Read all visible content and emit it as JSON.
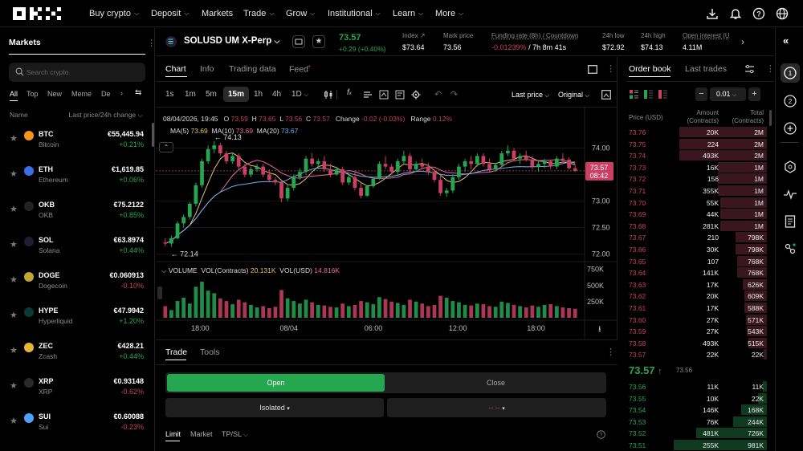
{
  "nav": {
    "logo": "OKX",
    "items": [
      {
        "label": "Buy crypto",
        "dropdown": true
      },
      {
        "label": "Deposit",
        "dropdown": true
      },
      {
        "label": "Markets",
        "dropdown": false
      },
      {
        "label": "Trade",
        "dropdown": true
      },
      {
        "label": "Grow",
        "dropdown": true
      },
      {
        "label": "Institutional",
        "dropdown": true
      },
      {
        "label": "Learn",
        "dropdown": true
      },
      {
        "label": "More",
        "dropdown": true
      }
    ],
    "right_icons": [
      "download-icon",
      "bell-icon",
      "help-icon",
      "globe-icon"
    ]
  },
  "markets": {
    "title": "Markets",
    "search_placeholder": "Search crypto",
    "filters": [
      "All",
      "Top",
      "New",
      "Meme",
      "De"
    ],
    "col_name": "Name",
    "col_price": "Last price/24h change",
    "rows": [
      {
        "sym": "BTC",
        "name": "Bitcoin",
        "price": "€55,445.94",
        "change": "+0.21%",
        "dir": "up",
        "color": "#f7931a"
      },
      {
        "sym": "ETH",
        "name": "Ethereum",
        "price": "€1,619.85",
        "change": "+0.06%",
        "dir": "up",
        "color": "#3b6ee8"
      },
      {
        "sym": "OKB",
        "name": "OKB",
        "price": "€75.2122",
        "change": "+0.85%",
        "dir": "up",
        "color": "#222222"
      },
      {
        "sym": "SOL",
        "name": "Solana",
        "price": "€63.8974",
        "change": "+0.44%",
        "dir": "up",
        "color": "#1f1f33"
      },
      {
        "sym": "DOGE",
        "name": "Dogecoin",
        "price": "€0.060913",
        "change": "-0.10%",
        "dir": "down",
        "color": "#c2a633"
      },
      {
        "sym": "HYPE",
        "name": "Hyperliquid",
        "price": "€47.9942",
        "change": "+1.20%",
        "dir": "up",
        "color": "#0c3a33"
      },
      {
        "sym": "ZEC",
        "name": "Zcash",
        "price": "€428.21",
        "change": "+0.44%",
        "dir": "up",
        "color": "#e8b43a"
      },
      {
        "sym": "XRP",
        "name": "XRP",
        "price": "€0.93148",
        "change": "-0.62%",
        "dir": "down",
        "color": "#2a2a2a"
      },
      {
        "sym": "SUI",
        "name": "Sui",
        "price": "€0.60088",
        "change": "-0.23%",
        "dir": "down",
        "color": "#4da2ff"
      }
    ]
  },
  "ticker": {
    "symbol": "SOLUSD UM X-Perp",
    "last": "73.57",
    "change": "+0.29 (+0.40%)",
    "stats": [
      {
        "label": "Index",
        "value": "$73.64"
      },
      {
        "label": "Mark price",
        "value": "73.56"
      },
      {
        "label": "Funding rate (8h) / Countdown",
        "value": "-0.01239%",
        "value2": "/ 7h 8m 41s"
      },
      {
        "label": "24h low",
        "value": "$72.92"
      },
      {
        "label": "24h high",
        "value": "$74.13"
      },
      {
        "label": "Open interest (U",
        "value": "4.11M"
      }
    ]
  },
  "chart": {
    "tabs": [
      "Chart",
      "Info",
      "Trading data",
      "Feed"
    ],
    "timeframes": [
      "1s",
      "1m",
      "5m",
      "15m",
      "1h",
      "4h",
      "1D"
    ],
    "active_timeframe": "15m",
    "price_mode": "Last price",
    "scale_mode": "Original",
    "ohlc": {
      "date": "08/04/2026, 19:45",
      "o_label": "O",
      "o": "73.59",
      "h_label": "H",
      "h": "73.65",
      "l_label": "L",
      "l": "73.56",
      "c_label": "C",
      "c": "73.57",
      "change_label": "Change",
      "change": "-0.02 (-0.03%)",
      "range_label": "Range",
      "range": "0.12%"
    },
    "ma": {
      "ma5_label": "MA(5)",
      "ma5": "73.69",
      "ma10_label": "MA(10)",
      "ma10": "73.69",
      "ma20_label": "MA(20)",
      "ma20": "73.67"
    },
    "high_marker": "74.13",
    "low_marker": "72.14",
    "price_axis": [
      "74.00",
      "73.50",
      "73.00",
      "72.50",
      "72.00"
    ],
    "current_price_tag": "73.57",
    "countdown_tag": "08:42",
    "volume_legend": {
      "label": "VOLUME",
      "contracts_label": "VOL(Contracts)",
      "contracts": "20.131K",
      "usd_label": "VOL(USD)",
      "usd": "14.816K"
    },
    "volume_axis": [
      "750K",
      "500K",
      "250K"
    ],
    "time_axis": [
      "18:00",
      "08/04",
      "06:00",
      "12:00",
      "18:00"
    ],
    "colors": {
      "up": "#25a750",
      "down": "#ca3f64",
      "ma5": "#e1c16a",
      "ma10": "#e86aa8",
      "ma20": "#6fb3ea"
    },
    "candles": [
      [
        72.22,
        72.3,
        72.15,
        72.2
      ],
      [
        72.2,
        72.35,
        72.14,
        72.3
      ],
      [
        72.3,
        72.62,
        72.28,
        72.58
      ],
      [
        72.58,
        72.75,
        72.5,
        72.7
      ],
      [
        72.7,
        72.98,
        72.65,
        72.95
      ],
      [
        72.95,
        73.35,
        72.9,
        73.3
      ],
      [
        73.3,
        73.8,
        73.25,
        73.75
      ],
      [
        73.75,
        74.05,
        73.7,
        73.98
      ],
      [
        73.98,
        74.13,
        73.9,
        74.05
      ],
      [
        74.05,
        74.1,
        73.85,
        73.9
      ],
      [
        73.9,
        73.95,
        73.7,
        73.75
      ],
      [
        73.75,
        73.9,
        73.7,
        73.85
      ],
      [
        73.85,
        73.9,
        73.6,
        73.65
      ],
      [
        73.65,
        73.7,
        73.45,
        73.5
      ],
      [
        73.5,
        73.65,
        73.45,
        73.6
      ],
      [
        73.6,
        73.7,
        73.55,
        73.65
      ],
      [
        73.65,
        73.7,
        73.45,
        73.5
      ],
      [
        73.5,
        73.6,
        73.35,
        73.4
      ],
      [
        73.4,
        73.45,
        73.3,
        73.35
      ],
      [
        73.35,
        73.4,
        72.98,
        73.05
      ],
      [
        73.05,
        73.3,
        73.0,
        73.25
      ],
      [
        73.25,
        73.5,
        73.2,
        73.45
      ],
      [
        73.45,
        73.62,
        73.4,
        73.55
      ],
      [
        73.55,
        73.85,
        73.5,
        73.8
      ],
      [
        73.8,
        73.9,
        73.65,
        73.7
      ],
      [
        73.7,
        73.8,
        73.6,
        73.75
      ],
      [
        73.75,
        73.85,
        73.55,
        73.6
      ],
      [
        73.6,
        73.7,
        73.45,
        73.5
      ],
      [
        73.5,
        73.65,
        73.48,
        73.6
      ],
      [
        73.6,
        73.65,
        73.3,
        73.35
      ],
      [
        73.35,
        73.5,
        73.3,
        73.45
      ],
      [
        73.45,
        73.55,
        73.2,
        73.25
      ],
      [
        73.25,
        73.35,
        73.05,
        73.1
      ],
      [
        73.1,
        73.3,
        73.08,
        73.28
      ],
      [
        73.28,
        73.45,
        73.25,
        73.42
      ],
      [
        73.42,
        73.75,
        73.4,
        73.7
      ],
      [
        73.7,
        73.85,
        73.6,
        73.65
      ],
      [
        73.65,
        73.7,
        73.5,
        73.55
      ],
      [
        73.55,
        73.8,
        73.5,
        73.75
      ],
      [
        73.75,
        73.95,
        73.7,
        73.85
      ],
      [
        73.85,
        73.9,
        73.55,
        73.6
      ],
      [
        73.6,
        73.75,
        73.55,
        73.7
      ],
      [
        73.7,
        73.8,
        73.6,
        73.65
      ],
      [
        73.65,
        73.72,
        73.5,
        73.55
      ],
      [
        73.55,
        73.6,
        73.35,
        73.4
      ],
      [
        73.4,
        73.5,
        73.1,
        73.15
      ],
      [
        73.15,
        73.25,
        73.08,
        73.2
      ],
      [
        73.2,
        73.5,
        73.15,
        73.45
      ],
      [
        73.45,
        73.7,
        73.4,
        73.65
      ],
      [
        73.65,
        73.8,
        73.55,
        73.75
      ],
      [
        73.75,
        73.85,
        73.6,
        73.7
      ],
      [
        73.7,
        73.9,
        73.65,
        73.85
      ],
      [
        73.85,
        73.9,
        73.65,
        73.7
      ],
      [
        73.7,
        73.8,
        73.55,
        73.6
      ],
      [
        73.6,
        73.72,
        73.55,
        73.68
      ],
      [
        73.68,
        73.95,
        73.65,
        73.9
      ],
      [
        73.9,
        74.05,
        73.85,
        73.95
      ],
      [
        73.95,
        74.0,
        73.75,
        73.8
      ],
      [
        73.8,
        73.9,
        73.7,
        73.85
      ],
      [
        73.85,
        73.95,
        73.75,
        73.78
      ],
      [
        73.78,
        73.85,
        73.6,
        73.65
      ],
      [
        73.65,
        73.75,
        73.55,
        73.7
      ],
      [
        73.7,
        73.8,
        73.62,
        73.75
      ],
      [
        73.75,
        73.78,
        73.6,
        73.65
      ],
      [
        73.65,
        73.85,
        73.6,
        73.8
      ],
      [
        73.8,
        73.9,
        73.7,
        73.78
      ],
      [
        73.78,
        73.82,
        73.6,
        73.62
      ],
      [
        73.62,
        73.7,
        73.55,
        73.57
      ]
    ],
    "volumes": [
      180,
      120,
      260,
      310,
      220,
      480,
      560,
      420,
      380,
      300,
      260,
      210,
      280,
      240,
      200,
      160,
      180,
      150,
      170,
      430,
      300,
      260,
      220,
      280,
      240,
      200,
      190,
      170,
      160,
      220,
      180,
      200,
      260,
      240,
      210,
      320,
      290,
      250,
      230,
      200,
      280,
      250,
      220,
      180,
      200,
      340,
      310,
      260,
      240,
      200,
      190,
      220,
      210,
      180,
      170,
      250,
      230,
      200,
      180,
      160,
      190,
      170,
      200,
      210,
      180,
      160,
      150,
      140
    ]
  },
  "trade": {
    "tabs": [
      "Trade",
      "Tools"
    ],
    "open_label": "Open",
    "close_label": "Close",
    "margin_mode": "Isolated",
    "leverage": "-- --",
    "order_types": [
      "Limit",
      "Market",
      "TP/SL"
    ]
  },
  "orderbook": {
    "tabs": [
      "Order book",
      "Last trades"
    ],
    "tick": "0.01",
    "col_price": "Price (USD)",
    "col_amount": "Amount",
    "col_amount_sub": "(Contracts)",
    "col_total": "Total",
    "col_total_sub": "(Contracts)",
    "asks": [
      {
        "price": "73.76",
        "amount": "20K",
        "total": "2M",
        "depth": 0.62
      },
      {
        "price": "73.75",
        "amount": "224",
        "total": "2M",
        "depth": 0.62
      },
      {
        "price": "73.74",
        "amount": "493K",
        "total": "2M",
        "depth": 0.62
      },
      {
        "price": "73.73",
        "amount": "16K",
        "total": "1M",
        "depth": 0.35
      },
      {
        "price": "73.72",
        "amount": "156",
        "total": "1M",
        "depth": 0.35
      },
      {
        "price": "73.71",
        "amount": "355K",
        "total": "1M",
        "depth": 0.35
      },
      {
        "price": "73.70",
        "amount": "55K",
        "total": "1M",
        "depth": 0.33
      },
      {
        "price": "73.69",
        "amount": "44K",
        "total": "1M",
        "depth": 0.33
      },
      {
        "price": "73.68",
        "amount": "281K",
        "total": "1M",
        "depth": 0.33
      },
      {
        "price": "73.67",
        "amount": "210",
        "total": "798K",
        "depth": 0.22
      },
      {
        "price": "73.66",
        "amount": "30K",
        "total": "798K",
        "depth": 0.22
      },
      {
        "price": "73.65",
        "amount": "107",
        "total": "768K",
        "depth": 0.21
      },
      {
        "price": "73.64",
        "amount": "141K",
        "total": "768K",
        "depth": 0.21
      },
      {
        "price": "73.63",
        "amount": "17K",
        "total": "626K",
        "depth": 0.17
      },
      {
        "price": "73.62",
        "amount": "20K",
        "total": "609K",
        "depth": 0.16
      },
      {
        "price": "73.61",
        "amount": "17K",
        "total": "588K",
        "depth": 0.16
      },
      {
        "price": "73.60",
        "amount": "27K",
        "total": "571K",
        "depth": 0.15
      },
      {
        "price": "73.59",
        "amount": "27K",
        "total": "543K",
        "depth": 0.14
      },
      {
        "price": "73.58",
        "amount": "493K",
        "total": "515K",
        "depth": 0.13
      },
      {
        "price": "73.57",
        "amount": "22K",
        "total": "22K",
        "depth": 0.02
      }
    ],
    "mid_price": "73.57",
    "mid_mark": "73.56",
    "bids": [
      {
        "price": "73.56",
        "amount": "11K",
        "total": "11K",
        "depth": 0.03
      },
      {
        "price": "73.55",
        "amount": "10K",
        "total": "22K",
        "depth": 0.06
      },
      {
        "price": "73.54",
        "amount": "146K",
        "total": "168K",
        "depth": 0.18
      },
      {
        "price": "73.53",
        "amount": "76K",
        "total": "244K",
        "depth": 0.24
      },
      {
        "price": "73.52",
        "amount": "481K",
        "total": "726K",
        "depth": 0.5
      },
      {
        "price": "73.51",
        "amount": "255K",
        "total": "981K",
        "depth": 0.66
      }
    ]
  }
}
